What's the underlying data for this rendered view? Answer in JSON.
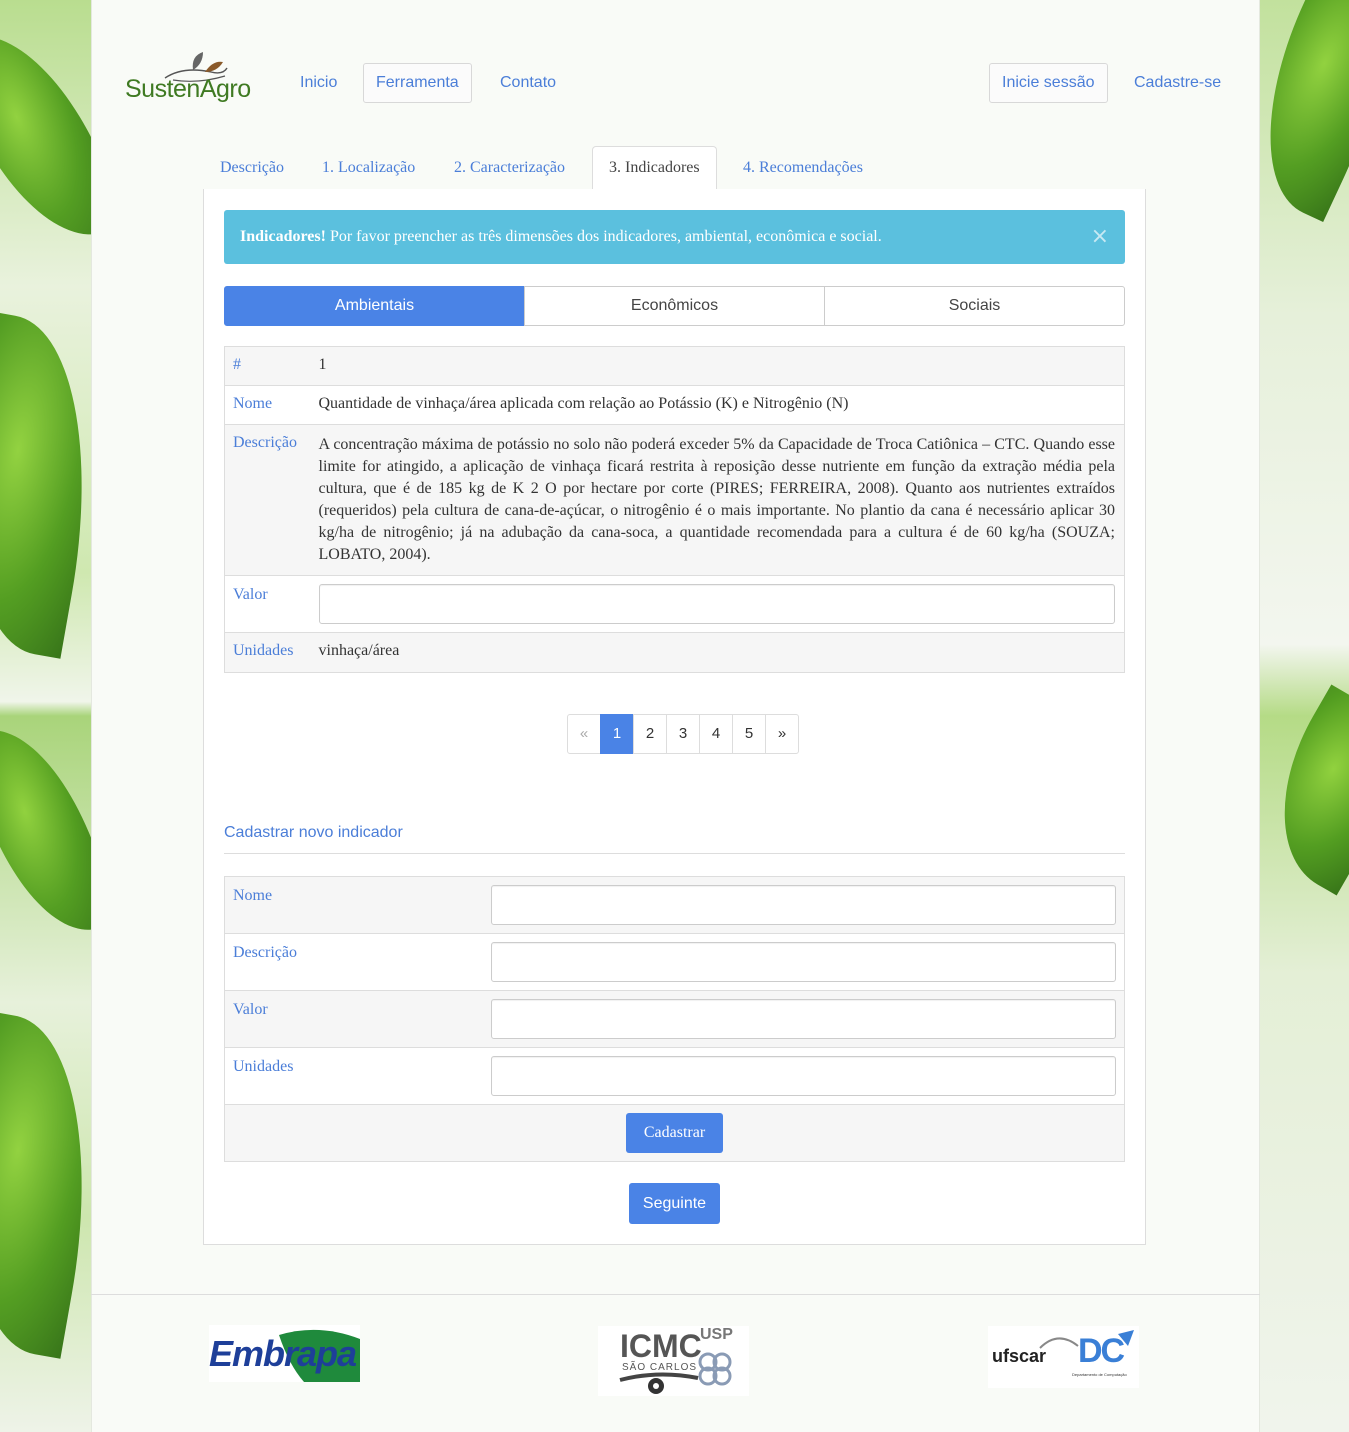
{
  "brand": {
    "name": "SustenAgro"
  },
  "nav": {
    "inicio": "Inicio",
    "ferramenta": "Ferramenta",
    "contato": "Contato",
    "login": "Inicie sessão",
    "signup": "Cadastre-se"
  },
  "tabs": [
    "Descrição",
    "1. Localização",
    "2. Caracterização",
    "3. Indicadores",
    "4. Recomendações"
  ],
  "alert": {
    "title": "Indicadores!",
    "message": "Por favor preencher as três dimensões dos indicadores, ambiental, econômica e social.",
    "close": "×"
  },
  "segments": [
    "Ambientais",
    "Econômicos",
    "Sociais"
  ],
  "indicator": {
    "num_label": "#",
    "num": "1",
    "nome_label": "Nome",
    "nome": "Quantidade de vinhaça/área aplicada com relação ao Potássio (K) e Nitrogênio (N)",
    "descricao_label": "Descrição",
    "descricao": "A concentração máxima de potássio no solo não poderá exceder 5% da Capacidade de Troca Catiônica – CTC. Quando esse limite for atingido, a aplicação de vinhaça ficará restrita à reposição desse nutriente em função da extração média pela cultura, que é de 185 kg de K 2 O por hectare por corte (PIRES; FERREIRA, 2008). Quanto aos nutrientes extraídos (requeridos) pela cultura de cana-de-açúcar, o nitrogênio é o mais importante. No plantio da cana é necessário aplicar 30 kg/ha de nitrogênio; já na adubação da cana-soca, a quantidade recomendada para a cultura é de 60 kg/ha (SOUZA; LOBATO, 2004).",
    "valor_label": "Valor",
    "valor": "",
    "unidades_label": "Unidades",
    "unidades": "vinhaça/área"
  },
  "pagination": {
    "prev": "«",
    "pages": [
      "1",
      "2",
      "3",
      "4",
      "5"
    ],
    "next": "»",
    "current": "1"
  },
  "new_indicator": {
    "title": "Cadastrar novo indicador",
    "nome_label": "Nome",
    "descricao_label": "Descrição",
    "valor_label": "Valor",
    "unidades_label": "Unidades",
    "submit": "Cadastrar"
  },
  "next_button": "Seguinte",
  "footer_logos": {
    "embrapa": "Embrapa",
    "icmc": "ICMC",
    "icmc_sub": "SÃO CARLOS",
    "usp": "USP",
    "ufscar": "ufscar",
    "dc": "DC",
    "dc_sub": "Departamento de Computação"
  },
  "colors": {
    "accent": "#4a83e6",
    "alert": "#5bc0de",
    "brand_green": "#3f7a22",
    "embrapa_blue": "#1e3f99",
    "embrapa_green": "#1f8a3c"
  }
}
